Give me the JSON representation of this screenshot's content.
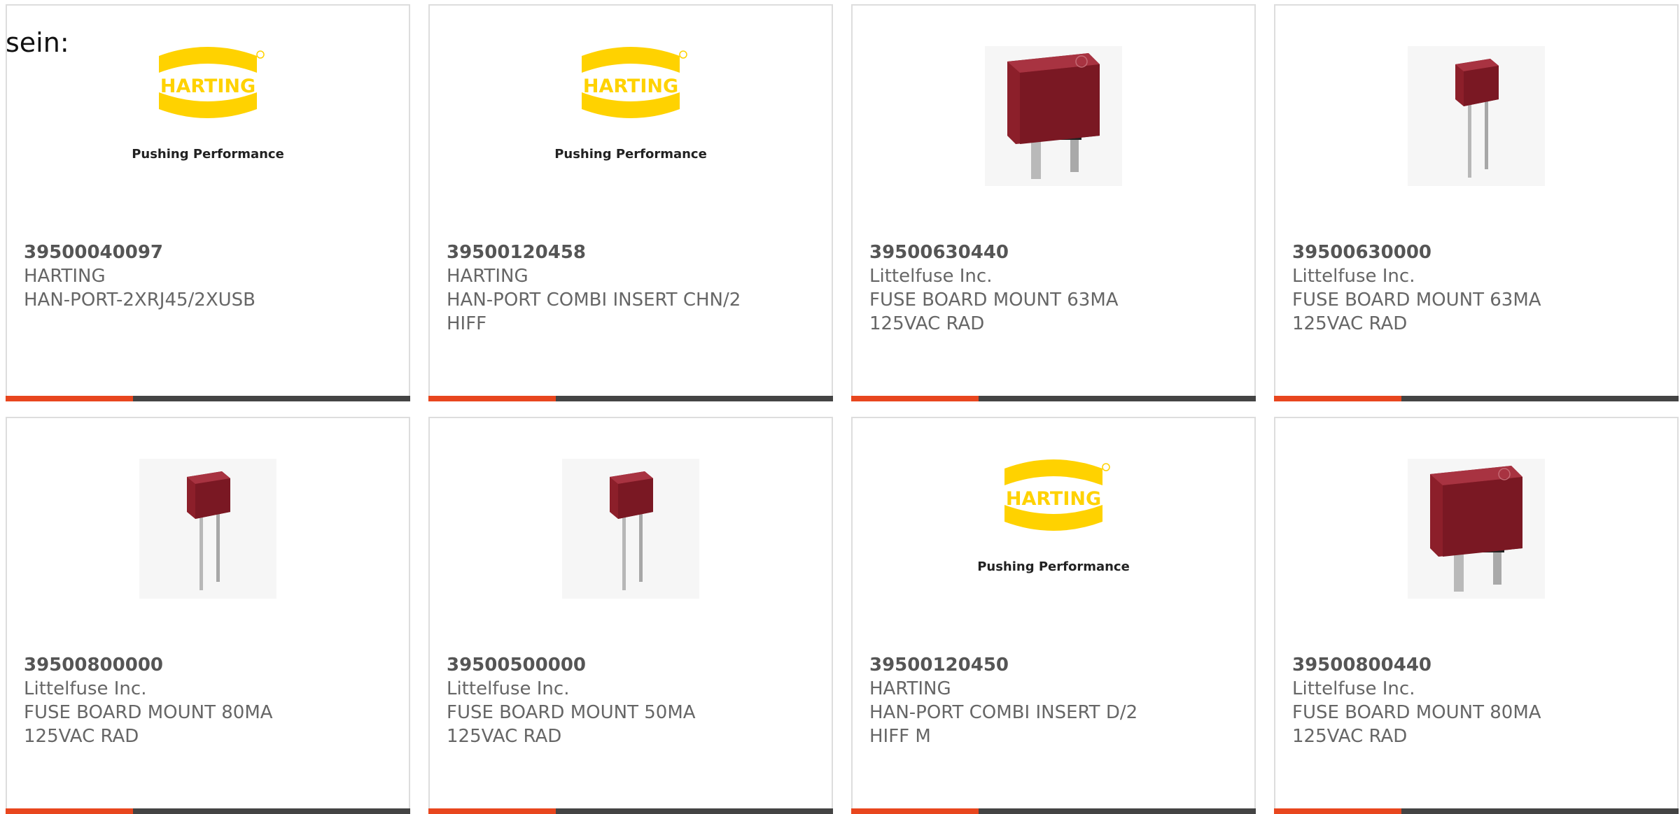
{
  "intro_text": "sein:",
  "colors": {
    "accent": "#e8461e",
    "bar": "#444444",
    "harting_yellow": "#ffd200",
    "fuse_red": "#8c1f2a"
  },
  "products": [
    {
      "part_number": "39500040097",
      "manufacturer": "HARTING",
      "description": "HAN-PORT-2XRJ45/2XUSB",
      "image": "harting-logo",
      "logo_text": "HARTING",
      "tagline": "Pushing Performance"
    },
    {
      "part_number": "39500120458",
      "manufacturer": "HARTING",
      "description": "HAN-PORT COMBI INSERT CHN/2\nHIFF",
      "image": "harting-logo",
      "logo_text": "HARTING",
      "tagline": "Pushing Performance"
    },
    {
      "part_number": "39500630440",
      "manufacturer": "Littelfuse Inc.",
      "description": "FUSE BOARD MOUNT 63MA\n125VAC RAD",
      "image": "fuse-large"
    },
    {
      "part_number": "39500630000",
      "manufacturer": "Littelfuse Inc.",
      "description": "FUSE BOARD MOUNT 63MA\n125VAC RAD",
      "image": "fuse-small"
    },
    {
      "part_number": "39500800000",
      "manufacturer": "Littelfuse Inc.",
      "description": "FUSE BOARD MOUNT 80MA\n125VAC RAD",
      "image": "fuse-small"
    },
    {
      "part_number": "39500500000",
      "manufacturer": "Littelfuse Inc.",
      "description": "FUSE BOARD MOUNT 50MA\n125VAC RAD",
      "image": "fuse-small"
    },
    {
      "part_number": "39500120450",
      "manufacturer": "HARTING",
      "description": "HAN-PORT COMBI INSERT D/2\nHIFF M",
      "image": "harting-logo",
      "logo_text": "HARTING",
      "tagline": "Pushing Performance"
    },
    {
      "part_number": "39500800440",
      "manufacturer": "Littelfuse Inc.",
      "description": "FUSE BOARD MOUNT 80MA\n125VAC RAD",
      "image": "fuse-large"
    }
  ]
}
